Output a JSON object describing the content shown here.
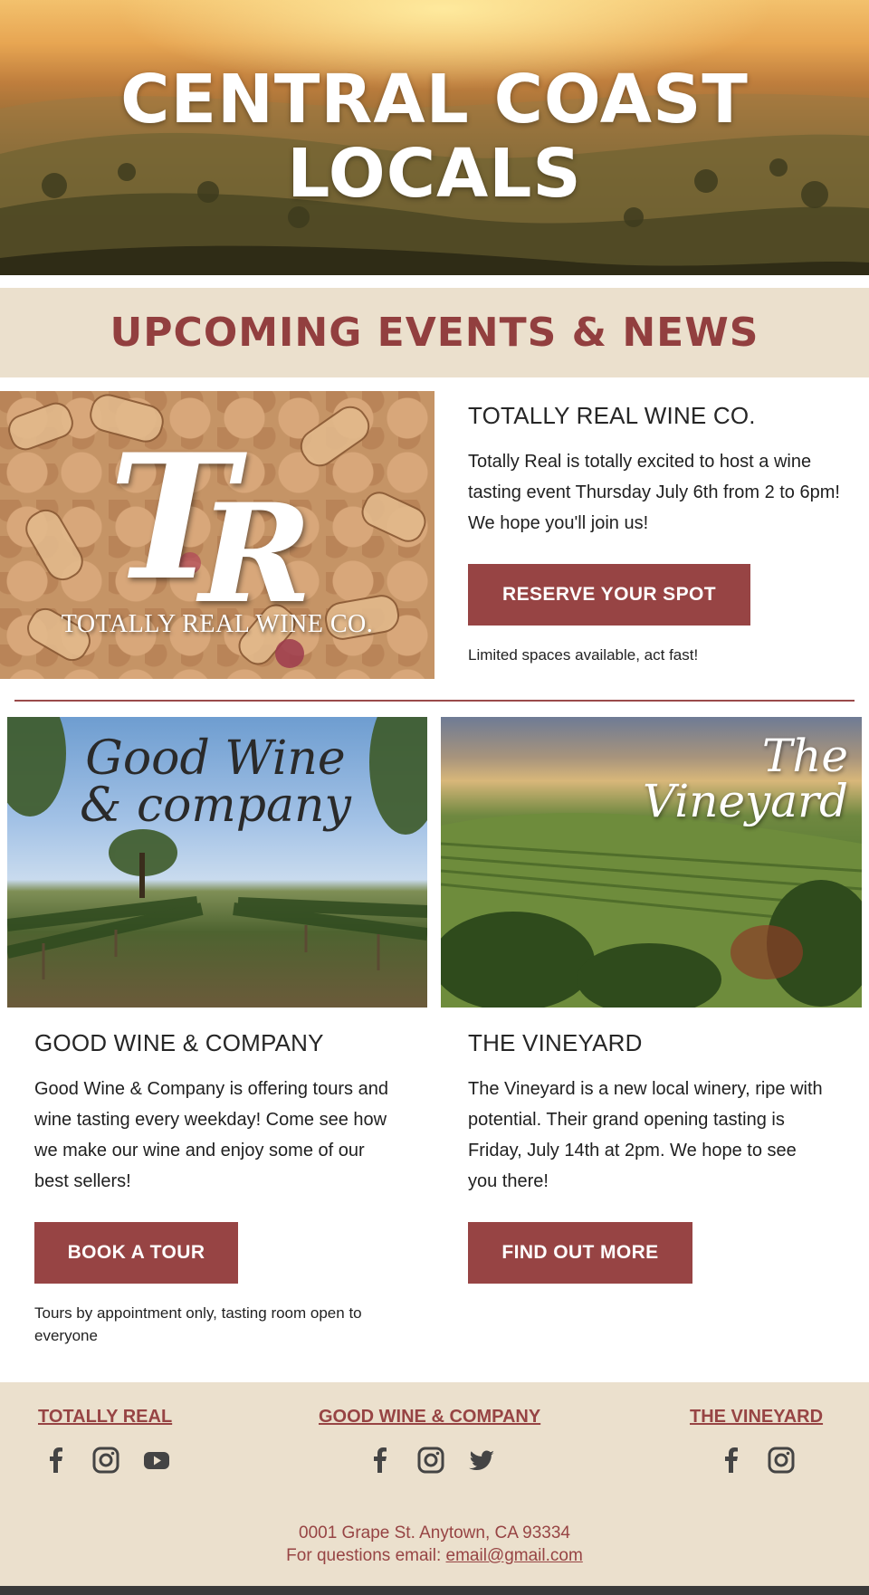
{
  "hero": {
    "line1": "CENTRAL COAST",
    "line2": "LOCALS"
  },
  "events": {
    "title": "UPCOMING EVENTS & NEWS"
  },
  "feature": {
    "logo_monogram_t": "T",
    "logo_monogram_r": "R",
    "logo_caption": "TOTALLY REAL WINE CO.",
    "heading": "TOTALLY REAL WINE CO.",
    "body": "Totally Real is totally excited to host a wine tasting event Thursday July 6th from 2 to 6pm! We hope you'll join us!",
    "button": "RESERVE YOUR SPOT",
    "note": "Limited spaces available, act fast!"
  },
  "columns": [
    {
      "image_script_line1": "Good Wine",
      "image_script_line2": "& company",
      "heading": "GOOD WINE & COMPANY",
      "body": "Good Wine & Company is offering tours and wine tasting every weekday! Come see how we make our wine and enjoy some of our best sellers!",
      "button": "BOOK A TOUR",
      "note": "Tours by appointment only, tasting room open to everyone"
    },
    {
      "image_script_line1": "The",
      "image_script_line2": "Vineyard",
      "heading": "THE VINEYARD",
      "body": "The Vineyard is a new local winery, ripe with potential. Their grand opening tasting is Friday, July 14th at 2pm. We hope to see you there!",
      "button": "FIND OUT MORE"
    }
  ],
  "footer": {
    "links": [
      "TOTALLY REAL",
      "GOOD WINE & COMPANY",
      "THE VINEYARD"
    ],
    "icons": {
      "totally_real": [
        "facebook-icon",
        "instagram-icon",
        "youtube-icon"
      ],
      "good_wine": [
        "facebook-icon",
        "instagram-icon",
        "twitter-icon"
      ],
      "vineyard": [
        "facebook-icon",
        "instagram-icon"
      ]
    },
    "address": "0001 Grape St. Anytown, CA  93334",
    "email_prefix": "For questions email: ",
    "email": "email@gmail.com"
  },
  "colors": {
    "accent": "#974444",
    "band": "#ebe0cd",
    "title_red": "#923f3f"
  }
}
